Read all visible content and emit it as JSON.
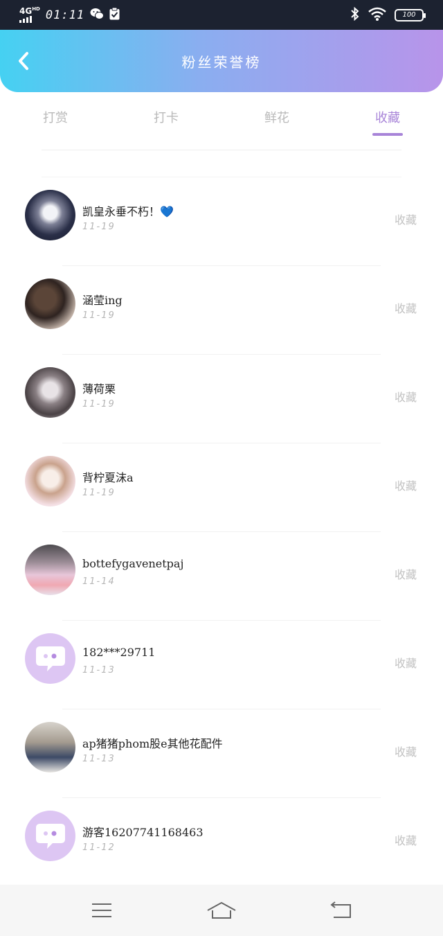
{
  "status_bar": {
    "network": "4G",
    "network_sup": "HD",
    "time": "01:11",
    "battery": "100"
  },
  "header": {
    "title": "粉丝荣誉榜"
  },
  "tabs": [
    {
      "label": "打赏",
      "active": false
    },
    {
      "label": "打卡",
      "active": false
    },
    {
      "label": "鲜花",
      "active": false
    },
    {
      "label": "收藏",
      "active": true
    }
  ],
  "list": [
    {
      "name": "凯皇永垂不朽！💙",
      "date": "11-19",
      "action": "收藏"
    },
    {
      "name": "涵莹ing",
      "date": "11-19",
      "action": "收藏"
    },
    {
      "name": "薄荷栗",
      "date": "11-19",
      "action": "收藏"
    },
    {
      "name": "背柠夏沫a",
      "date": "11-19",
      "action": "收藏"
    },
    {
      "name": "bottefygavenetpaj",
      "date": "11-14",
      "action": "收藏"
    },
    {
      "name": "182***29711",
      "date": "11-13",
      "action": "收藏"
    },
    {
      "name": "ap猪猪phom股e其他花配件",
      "date": "11-13",
      "action": "收藏"
    },
    {
      "name": "游客16207741168463",
      "date": "11-12",
      "action": "收藏"
    }
  ],
  "colors": {
    "accent": "#a884d8",
    "header_start": "#45d1f2",
    "header_end": "#b894ea",
    "placeholder_avatar": "#ddc6f3"
  }
}
